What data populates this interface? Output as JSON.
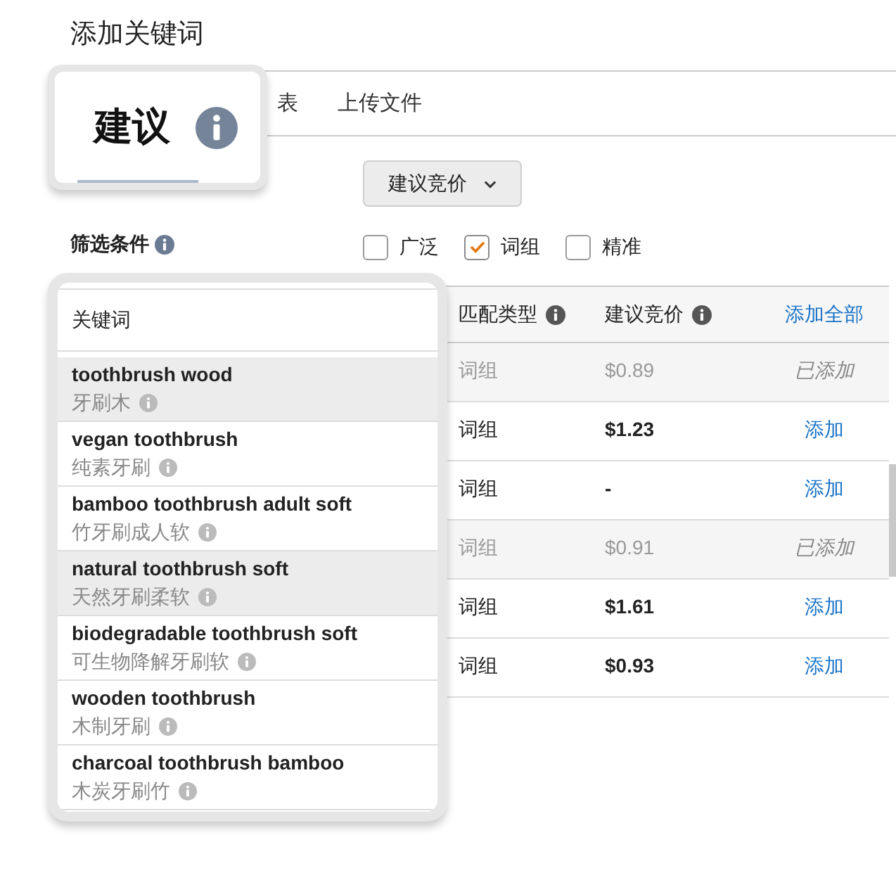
{
  "title": "添加关键词",
  "tabs": [
    {
      "label": "表",
      "selected": false
    },
    {
      "label": "上传文件",
      "selected": false
    }
  ],
  "zoom_tab": {
    "label": "建议",
    "selected": true
  },
  "bid_dropdown": {
    "value": "建议竞价"
  },
  "filter": {
    "label": "筛选条件",
    "options": [
      {
        "label": "广泛",
        "checked": false
      },
      {
        "label": "词组",
        "checked": true
      },
      {
        "label": "精准",
        "checked": false
      }
    ]
  },
  "table": {
    "columns": [
      "匹配类型",
      "建议竞价"
    ],
    "add_all": "添加全部",
    "rows": [
      {
        "match": "词组",
        "bid": "$0.89",
        "added": true,
        "action": "已添加"
      },
      {
        "match": "词组",
        "bid": "$1.23",
        "added": false,
        "action": "添加"
      },
      {
        "match": "词组",
        "bid": "-",
        "added": false,
        "action": "添加"
      },
      {
        "match": "词组",
        "bid": "$0.91",
        "added": true,
        "action": "已添加"
      },
      {
        "match": "词组",
        "bid": "$1.61",
        "added": false,
        "action": "添加"
      },
      {
        "match": "词组",
        "bid": "$0.93",
        "added": false,
        "action": "添加"
      }
    ]
  },
  "zoom_panel": {
    "column": "关键词",
    "rows": [
      {
        "keyword": "toothbrush wood",
        "translation": "牙刷木",
        "added": true
      },
      {
        "keyword": "vegan toothbrush",
        "translation": "纯素牙刷",
        "added": false
      },
      {
        "keyword": "bamboo toothbrush adult soft",
        "translation": "竹牙刷成人软",
        "added": false
      },
      {
        "keyword": "natural toothbrush soft",
        "translation": "天然牙刷柔软",
        "added": true
      },
      {
        "keyword": "biodegradable toothbrush soft",
        "translation": "可生物降解牙刷软",
        "added": false
      },
      {
        "keyword": "wooden toothbrush",
        "translation": "木制牙刷",
        "added": false
      },
      {
        "keyword": "charcoal toothbrush bamboo",
        "translation": "木炭牙刷竹",
        "added": false
      }
    ]
  }
}
